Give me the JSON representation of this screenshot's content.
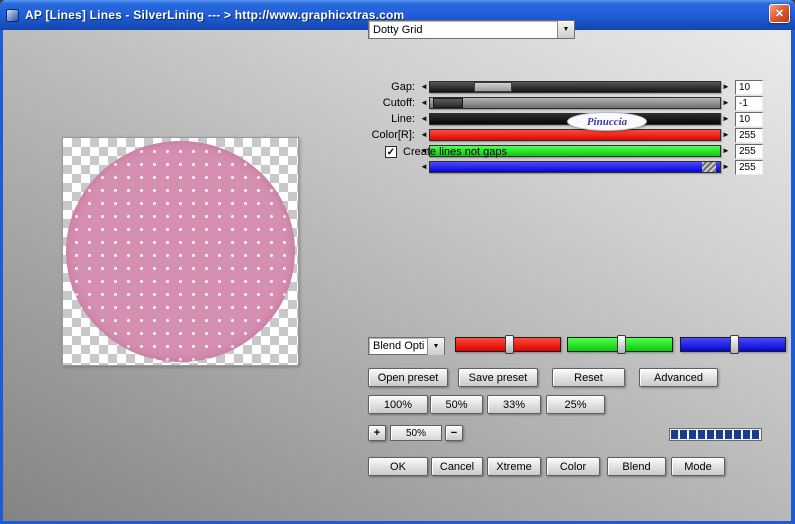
{
  "window": {
    "title": "AP [Lines]  Lines - SilverLining    --- > http://www.graphicxtras.com"
  },
  "icons": {
    "close": "✕",
    "dropdown_arrow": "▼",
    "arrow_left": "◄",
    "arrow_right": "►",
    "check": "✓"
  },
  "pattern_select": {
    "value": "Dotty Grid"
  },
  "sliders": [
    {
      "label": "Gap:",
      "value": "10"
    },
    {
      "label": "Cutoff:",
      "value": "-1"
    },
    {
      "label": "Line:",
      "value": "10"
    },
    {
      "label": "Color[R]:",
      "value": "255"
    },
    {
      "label": "",
      "value": "255"
    },
    {
      "label": "",
      "value": "255"
    }
  ],
  "options": {
    "create_lines_label": "Create lines not gaps",
    "checked": true
  },
  "watermark": {
    "text": "Pinuccia"
  },
  "blend_select": {
    "value": "Blend Opti"
  },
  "preset_buttons": [
    "Open preset",
    "Save preset",
    "Reset",
    "Advanced"
  ],
  "zoom_buttons": [
    "100%",
    "50%",
    "33%",
    "25%"
  ],
  "scale_controls": {
    "plus": "+",
    "value": "50%",
    "minus": "−"
  },
  "action_buttons": [
    "OK",
    "Cancel",
    "Xtreme",
    "Color",
    "Blend",
    "Mode"
  ],
  "colors": {
    "titlebar_blue": "#1e5cd6",
    "border_blue": "#1c5cd6",
    "slider_red": "#dc0800",
    "slider_green": "#0ec80e",
    "slider_blue": "#0404d2",
    "progress_blue": "#1a3c8c",
    "preview_pink": "#d58fb2"
  }
}
